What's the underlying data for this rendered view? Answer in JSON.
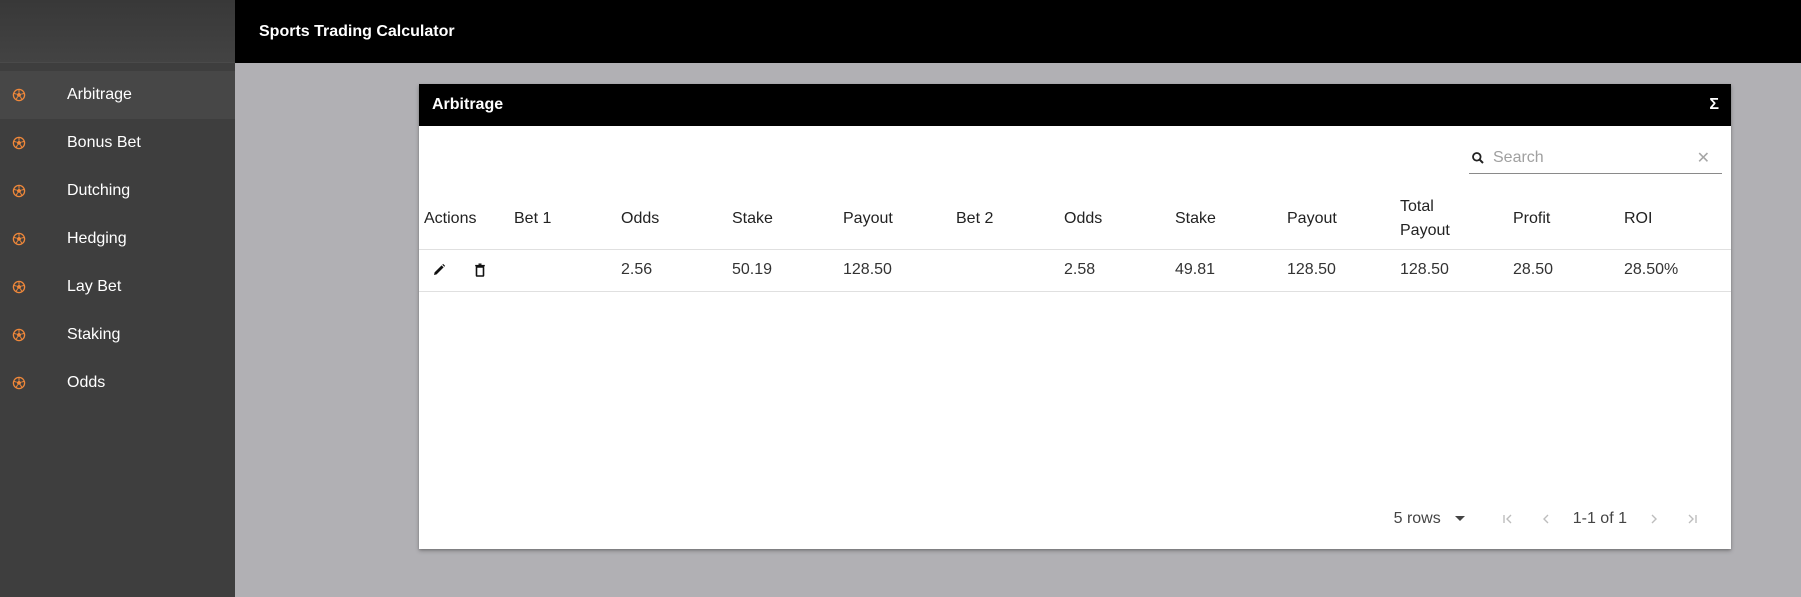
{
  "app": {
    "title": "Sports Trading Calculator"
  },
  "sidebar": {
    "items": [
      {
        "label": "Arbitrage",
        "active": true
      },
      {
        "label": "Bonus Bet"
      },
      {
        "label": "Dutching"
      },
      {
        "label": "Hedging"
      },
      {
        "label": "Lay Bet"
      },
      {
        "label": "Staking"
      },
      {
        "label": "Odds"
      }
    ],
    "icon": "soccer-ball-icon",
    "icon_color": "#f0883a"
  },
  "card": {
    "title": "Arbitrage",
    "summary_icon": "Σ"
  },
  "search": {
    "placeholder": "Search",
    "value": ""
  },
  "table": {
    "headers": [
      "Actions",
      "Bet 1",
      "Odds",
      "Stake",
      "Payout",
      "Bet 2",
      "Odds",
      "Stake",
      "Payout",
      "Total Payout",
      "Profit",
      "ROI"
    ],
    "rows": [
      {
        "bet1": "",
        "odds1": "2.56",
        "stake1": "50.19",
        "payout1": "128.50",
        "bet2": "",
        "odds2": "2.58",
        "stake2": "49.81",
        "payout2": "128.50",
        "total_payout": "128.50",
        "profit": "28.50",
        "roi": "28.50%"
      }
    ]
  },
  "pagination": {
    "rows_per_page": "5 rows",
    "range": "1-1 of 1"
  }
}
